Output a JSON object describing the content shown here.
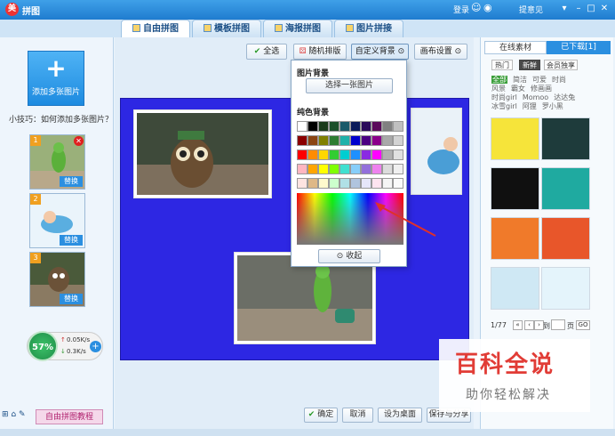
{
  "app": {
    "title": "拼图",
    "login": "登录",
    "feedback": "提意见"
  },
  "tabs": [
    "自由拼图",
    "模板拼图",
    "海报拼图",
    "图片拼接"
  ],
  "left": {
    "add_label": "添加多张图片",
    "tip": "小技巧：如何添加多张图片？",
    "replace": "替换",
    "thumb_nums": [
      "1",
      "2",
      "3"
    ],
    "speed_percent": "57%",
    "upload": "0.05K/s",
    "download": "0.3K/s",
    "tutorial": "自由拼图教程"
  },
  "toolbar": {
    "select_all": "全选",
    "random_layout": "随机排版",
    "custom_bg": "自定义背景",
    "canvas_settings": "画布设置"
  },
  "dropdown": {
    "image_bg": "图片背景",
    "choose_image": "选择一张图片",
    "solid_bg": "纯色背景",
    "collapse": "收起"
  },
  "swatch_colors": [
    "#ffffff",
    "#000000",
    "#1a3a1a",
    "#1b4f2a",
    "#1a5a6a",
    "#0a1a5a",
    "#2a0a5a",
    "#5a0a5a",
    "#808080",
    "#c0c0c0",
    "#8b0000",
    "#8b4513",
    "#808000",
    "#2e7d32",
    "#20b2aa",
    "#0000cd",
    "#4b0082",
    "#8b008b",
    "#a9a9a9",
    "#d3d3d3",
    "#ff0000",
    "#ff8c00",
    "#ffd700",
    "#32cd32",
    "#00ced1",
    "#1e90ff",
    "#8a2be2",
    "#ff00ff",
    "#b0b0b0",
    "#e0e0e0",
    "#ffb6c1",
    "#ffa500",
    "#ffff00",
    "#7fff00",
    "#40e0d0",
    "#87cefa",
    "#9370db",
    "#ee82ee",
    "#dcdcdc",
    "#f0f0f0",
    "#ffe4e1",
    "#deb887",
    "#fffacd",
    "#ccffcc",
    "#b0e0e6",
    "#b0c4de",
    "#e6e6fa",
    "#ffe4f0",
    "#f5f5f5",
    "#fafafa"
  ],
  "bottom": {
    "confirm": "确定",
    "cancel": "取消",
    "set_desktop": "设为桌面",
    "save_share": "保存与分享"
  },
  "right": {
    "online": "在线素材",
    "downloaded": "已下载[1]",
    "categories": [
      "热门",
      "新鲜",
      "会员独享"
    ],
    "keywords": [
      [
        "全部",
        "简洁",
        "可爱",
        "时尚"
      ],
      [
        "风景",
        "霸女",
        "修画画"
      ],
      [
        "时尚girl",
        "Momoo",
        "达达兔"
      ],
      [
        "冰雪girl",
        "阿狸",
        "罗小黑"
      ]
    ],
    "page_info": "1/77",
    "goto": "到",
    "page_unit": "页",
    "go": "GO"
  },
  "watermark": {
    "title": "百科全说",
    "sub": "助你轻松解决"
  }
}
